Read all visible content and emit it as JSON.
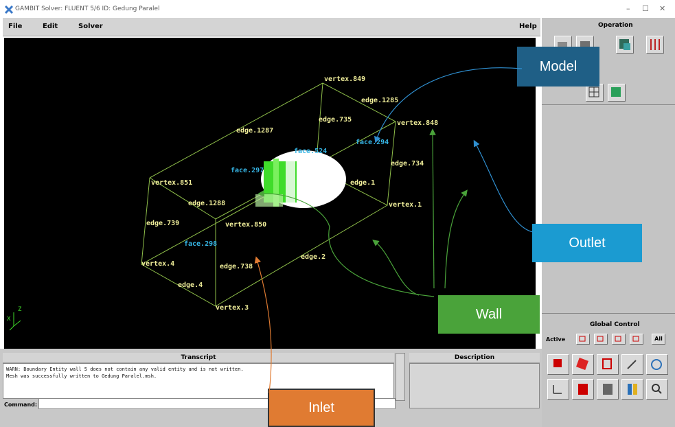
{
  "window": {
    "title": "GAMBIT   Solver: FLUENT 5/6   ID: Gedung Paralel",
    "minimize": "–",
    "maximize": "☐",
    "close": "✕"
  },
  "menu": {
    "file": "File",
    "edit": "Edit",
    "solver": "Solver",
    "help": "Help"
  },
  "viewport": {
    "labels": [
      {
        "text": "vertex.849",
        "color": "#f0ee9a"
      },
      {
        "text": "edge.1285",
        "color": "#f0ee9a"
      },
      {
        "text": "edge.735",
        "color": "#f0ee9a"
      },
      {
        "text": "vertex.848",
        "color": "#f0ee9a"
      },
      {
        "text": "edge.1287",
        "color": "#f0ee9a"
      },
      {
        "text": "face.294",
        "color": "#36b6e6"
      },
      {
        "text": "face.524",
        "color": "#36b6e6"
      },
      {
        "text": "edge.734",
        "color": "#f0ee9a"
      },
      {
        "text": "face.297",
        "color": "#36b6e6"
      },
      {
        "text": "vertex.851",
        "color": "#f0ee9a"
      },
      {
        "text": "edge.1",
        "color": "#f0ee9a"
      },
      {
        "text": "edge.1288",
        "color": "#f0ee9a"
      },
      {
        "text": "vertex.1",
        "color": "#f0ee9a"
      },
      {
        "text": "edge.739",
        "color": "#f0ee9a"
      },
      {
        "text": "vertex.850",
        "color": "#f0ee9a"
      },
      {
        "text": "face.298",
        "color": "#36b6e6"
      },
      {
        "text": "vertex.4",
        "color": "#f0ee9a"
      },
      {
        "text": "edge.738",
        "color": "#f0ee9a"
      },
      {
        "text": "edge.2",
        "color": "#f0ee9a"
      },
      {
        "text": "edge.4",
        "color": "#f0ee9a"
      },
      {
        "text": "vertex.3",
        "color": "#f0ee9a"
      }
    ],
    "axis_x": "X",
    "axis_z": "Z"
  },
  "right_panel": {
    "operation_title": "Operation",
    "global_control_title": "Global Control",
    "active_label": "Active",
    "all_label": "All"
  },
  "bottom": {
    "transcript_title": "Transcript",
    "transcript_lines": [
      "WARN:  Boundary Entity wall 5 does not contain any valid entity and is not written.",
      "Mesh was successfully written to Gedung Paralel.msh."
    ],
    "description_title": "Description",
    "command_label": "Command:",
    "command_value": ""
  },
  "callouts": {
    "model": {
      "text": "Model",
      "color": "#1f5f86"
    },
    "outlet": {
      "text": "Outlet",
      "color": "#1b9bd1"
    },
    "wall": {
      "text": "Wall",
      "color": "#4aa33a"
    },
    "inlet": {
      "text": "Inlet",
      "color": "#e07b32"
    }
  },
  "icons": [
    "app-logo-icon",
    "geometry-icon",
    "mesh-icon",
    "zones-icon",
    "tools-icon",
    "grid-icon",
    "fit-to-window-icon",
    "select-icon",
    "render-icon",
    "orient-icon",
    "undo-icon",
    "axes-icon",
    "shade-icon",
    "hide-icon",
    "color-icon",
    "search-icon"
  ]
}
